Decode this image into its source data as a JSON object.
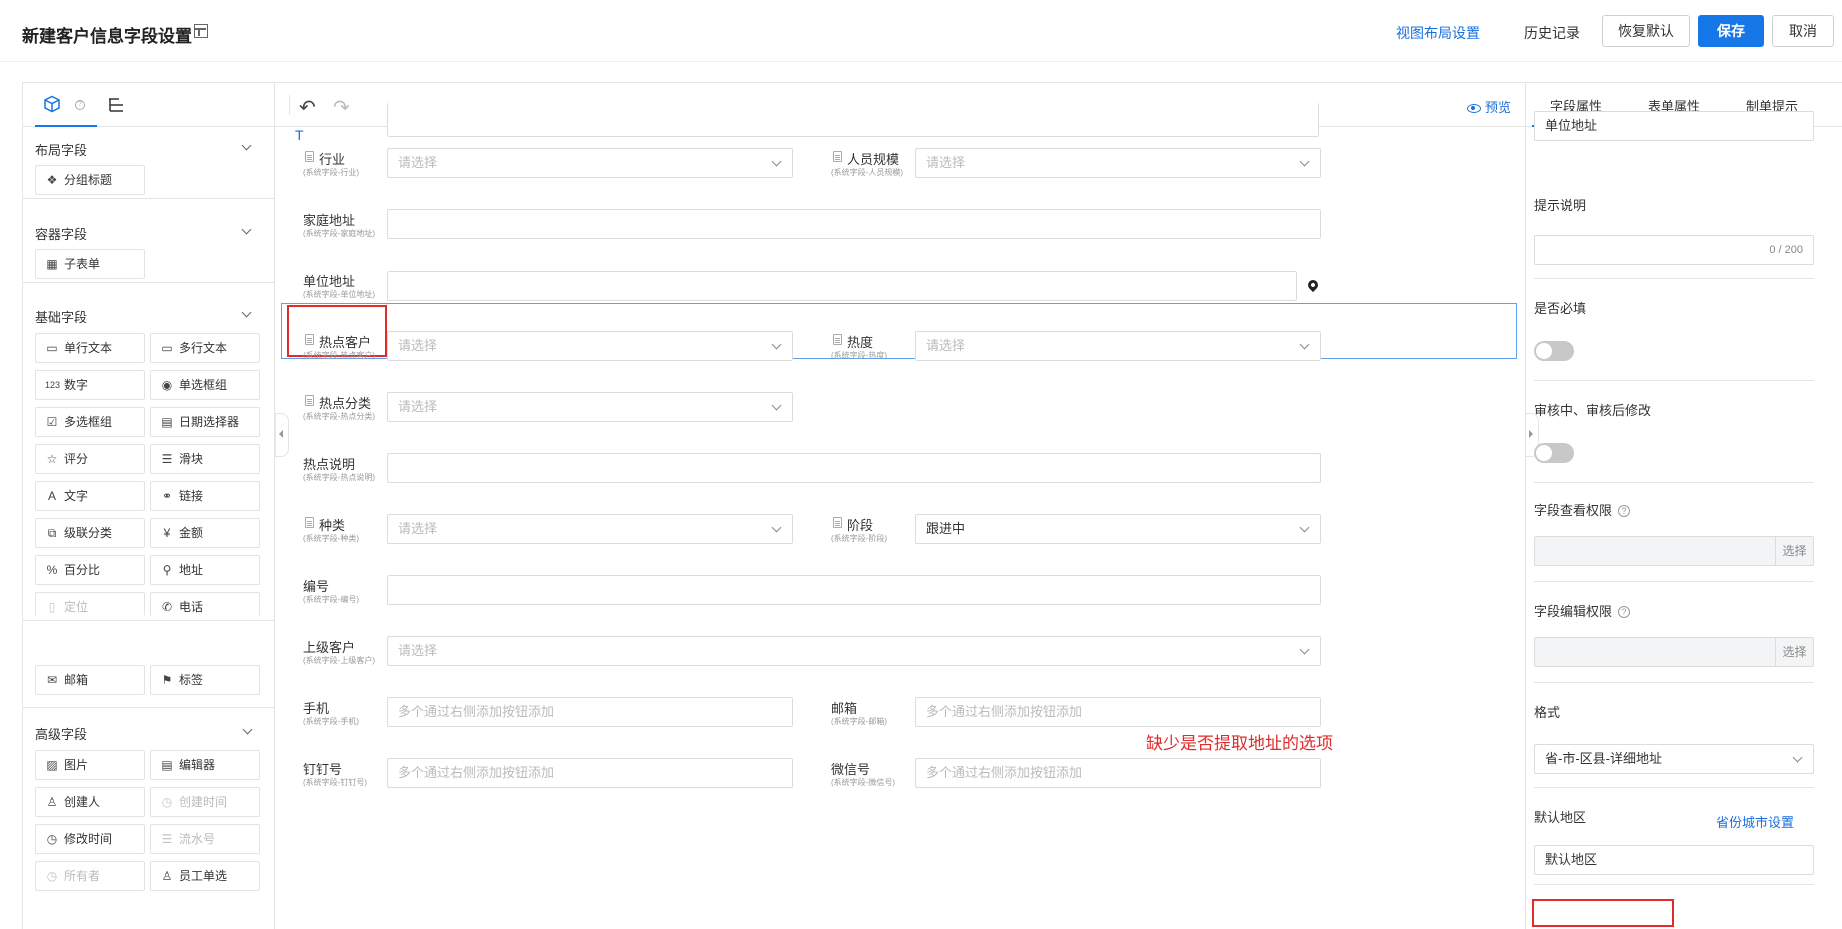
{
  "header": {
    "title": "新建客户信息字段设置",
    "view_layout": "视图布局设置",
    "history": "历史记录",
    "restore_default": "恢复默认",
    "save": "保存",
    "cancel": "取消"
  },
  "left_panel": {
    "sections": [
      {
        "title": "布局字段",
        "items": [
          {
            "label": "分组标题",
            "icon": "layout-group-icon",
            "disabled": false
          }
        ]
      },
      {
        "title": "容器字段",
        "items": [
          {
            "label": "子表单",
            "icon": "table-icon",
            "disabled": false
          }
        ]
      },
      {
        "title": "基础字段",
        "items": [
          {
            "label": "单行文本",
            "icon": "single-line-text-icon",
            "disabled": false
          },
          {
            "label": "多行文本",
            "icon": "multi-line-text-icon",
            "disabled": false
          },
          {
            "label": "数字",
            "icon": "number-icon",
            "disabled": false
          },
          {
            "label": "单选框组",
            "icon": "radio-icon",
            "disabled": false
          },
          {
            "label": "多选框组",
            "icon": "checkbox-icon",
            "disabled": false
          },
          {
            "label": "日期选择器",
            "icon": "calendar-icon",
            "disabled": false
          },
          {
            "label": "评分",
            "icon": "star-icon",
            "disabled": false
          },
          {
            "label": "滑块",
            "icon": "slider-icon",
            "disabled": false
          },
          {
            "label": "文字",
            "icon": "text-icon",
            "disabled": false
          },
          {
            "label": "链接",
            "icon": "link-icon",
            "disabled": false
          },
          {
            "label": "级联分类",
            "icon": "cascade-icon",
            "disabled": false
          },
          {
            "label": "金额",
            "icon": "money-icon",
            "disabled": false
          },
          {
            "label": "百分比",
            "icon": "percent-icon",
            "disabled": false
          },
          {
            "label": "地址",
            "icon": "location-icon",
            "disabled": false
          },
          {
            "label": "定位",
            "icon": "position-icon",
            "disabled": true
          },
          {
            "label": "电话",
            "icon": "phone-icon",
            "disabled": false
          },
          {
            "label": "邮箱",
            "icon": "mail-icon",
            "disabled": false
          },
          {
            "label": "标签",
            "icon": "tag-icon",
            "disabled": false
          }
        ]
      },
      {
        "title": "高级字段",
        "items": [
          {
            "label": "图片",
            "icon": "image-icon",
            "disabled": false
          },
          {
            "label": "编辑器",
            "icon": "editor-icon",
            "disabled": false
          },
          {
            "label": "创建人",
            "icon": "user-icon",
            "disabled": false
          },
          {
            "label": "创建时间",
            "icon": "clock-icon",
            "disabled": true
          },
          {
            "label": "修改时间",
            "icon": "clock-icon",
            "disabled": false
          },
          {
            "label": "流水号",
            "icon": "serial-icon",
            "disabled": true
          },
          {
            "label": "所有者",
            "icon": "owner-icon",
            "disabled": true
          },
          {
            "label": "员工单选",
            "icon": "user-icon",
            "disabled": false
          }
        ]
      }
    ]
  },
  "center": {
    "preview": "预览",
    "fields": [
      {
        "label": "行业",
        "sub": "(系统字段-行业)",
        "placeholder": "请选择",
        "type": "select",
        "doc": true
      },
      {
        "label": "人员规模",
        "sub": "(系统字段-人员规模)",
        "placeholder": "请选择",
        "type": "select",
        "doc": true
      },
      {
        "label": "家庭地址",
        "sub": "(系统字段-家庭地址)",
        "placeholder": "",
        "type": "text",
        "doc": false
      },
      {
        "label": "单位地址",
        "sub": "(系统字段-单位地址)",
        "placeholder": "",
        "type": "address",
        "doc": false
      },
      {
        "label": "热点客户",
        "sub": "(系统字段-热点客户)",
        "placeholder": "请选择",
        "type": "select",
        "doc": true
      },
      {
        "label": "热度",
        "sub": "(系统字段-热度)",
        "placeholder": "请选择",
        "type": "select",
        "doc": true
      },
      {
        "label": "热点分类",
        "sub": "(系统字段-热点分类)",
        "placeholder": "请选择",
        "type": "select",
        "doc": true
      },
      {
        "label": "热点说明",
        "sub": "(系统字段-热点说明)",
        "placeholder": "",
        "type": "text",
        "doc": false
      },
      {
        "label": "种类",
        "sub": "(系统字段-种类)",
        "placeholder": "请选择",
        "type": "select",
        "doc": true
      },
      {
        "label": "阶段",
        "sub": "(系统字段-阶段)",
        "value": "跟进中",
        "type": "select",
        "doc": true
      },
      {
        "label": "编号",
        "sub": "(系统字段-编号)",
        "placeholder": "",
        "type": "text",
        "doc": false
      },
      {
        "label": "上级客户",
        "sub": "(系统字段-上级客户)",
        "placeholder": "请选择",
        "type": "select",
        "doc": false
      },
      {
        "label": "手机",
        "sub": "(系统字段-手机)",
        "placeholder": "多个通过右侧添加按钮添加",
        "type": "text",
        "doc": false
      },
      {
        "label": "邮箱",
        "sub": "(系统字段-邮箱)",
        "placeholder": "多个通过右侧添加按钮添加",
        "type": "text",
        "doc": false
      },
      {
        "label": "钉钉号",
        "sub": "(系统字段-钉钉号)",
        "placeholder": "多个通过右侧添加按钮添加",
        "type": "text",
        "doc": false
      },
      {
        "label": "微信号",
        "sub": "(系统字段-微信号)",
        "placeholder": "多个通过右侧添加按钮添加",
        "type": "text",
        "doc": false
      }
    ],
    "annotation": "缺少是否提取地址的选项"
  },
  "right_panel": {
    "tabs": [
      "字段属性",
      "表单属性",
      "制单提示"
    ],
    "field_name": "单位地址",
    "hint_label": "提示说明",
    "hint_counter": "0 / 200",
    "required_label": "是否必填",
    "review_edit_label": "审核中、审核后修改",
    "view_permission_label": "字段查看权限",
    "edit_permission_label": "字段编辑权限",
    "select_label": "选择",
    "format_label": "格式",
    "format_value": "省-市-区县-详细地址",
    "default_region_label": "默认地区",
    "province_city_setting": "省份城市设置",
    "default_region_value": "默认地区"
  }
}
